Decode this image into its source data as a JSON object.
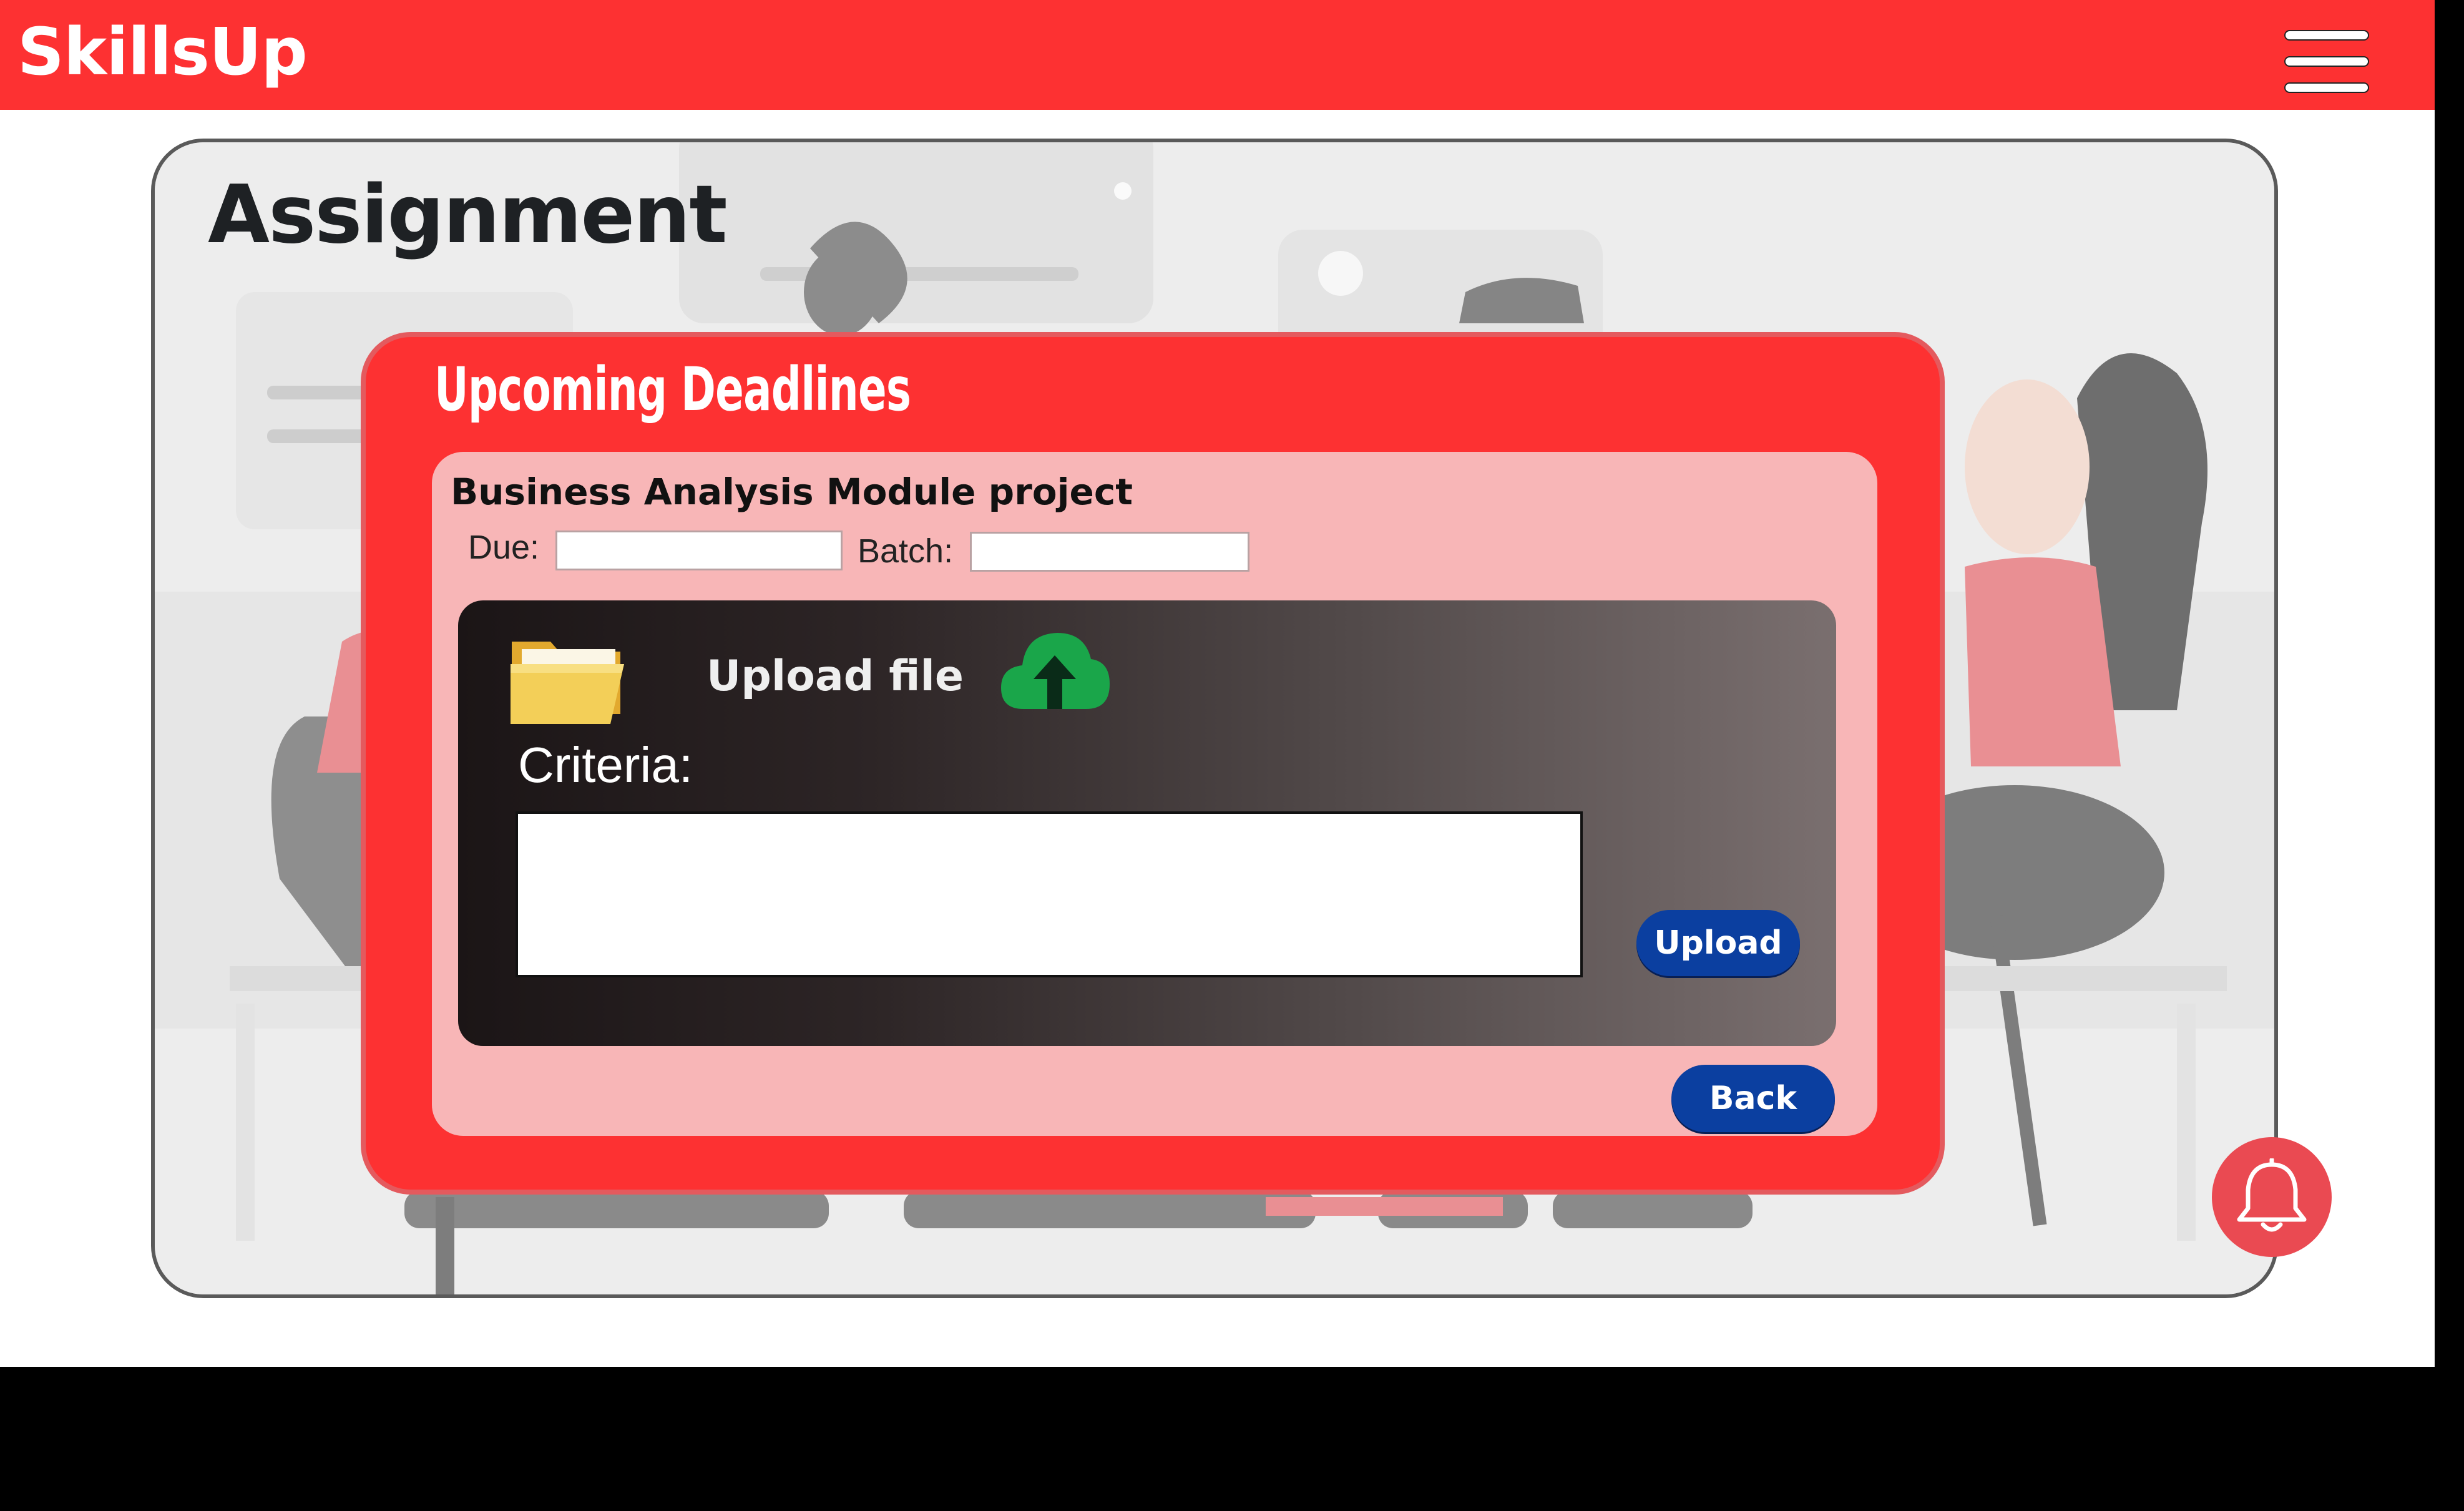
{
  "app": {
    "brand": "SkillsUp"
  },
  "header": {
    "menu_icon": "hamburger-menu-icon"
  },
  "page": {
    "title": "Assignment"
  },
  "modal": {
    "title": "Upcoming Deadlines",
    "project_title": "Business Analysis Module project",
    "due_label": "Due:",
    "due_value": "",
    "batch_label": "Batch:",
    "batch_value": "",
    "upload": {
      "folder_icon": "folder-icon",
      "label": "Upload file",
      "cloud_icon": "cloud-upload-icon",
      "criteria_label": "Criteria:",
      "criteria_value": "",
      "upload_button": "Upload"
    },
    "back_button": "Back"
  },
  "notifications": {
    "icon": "bell-icon"
  },
  "colors": {
    "brand_red": "#fd3132",
    "card_pink": "#f8b6b7",
    "button_blue": "#0b3fa0",
    "cloud_green": "#1aa64a",
    "folder_yellow": "#f3cf58"
  }
}
